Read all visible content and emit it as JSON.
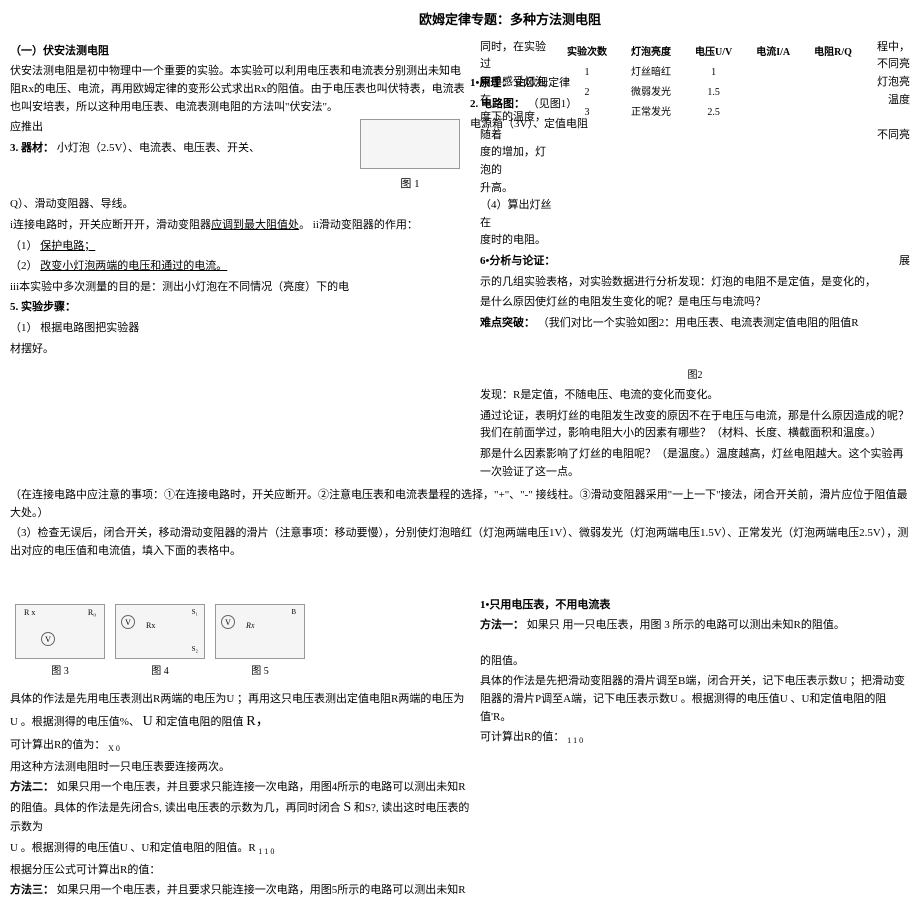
{
  "title": "欧姆定律专题：多种方法测电阻",
  "section1": {
    "header": "（一）伏安法测电阻",
    "intro": "伏安法测电阻是初中物理中一个重要的实验。本实验可以利用电压表和电流表分别测出未知电阻Rx的电压、电流，再用欧姆定律的变形公式求出Rx的阻值。由于电压表也叫伏特表，电流表也叫安培表，所以这种用电压表、电流表测电阻的方法叫\"伏安法\"。",
    "principle_label": "1•原理：",
    "principle_text": "由欧姆定律",
    "derive": "应推出",
    "circuit_label": "2. 电路图：",
    "circuit_text": "（见图1）",
    "equipment_label": "3. 器材：",
    "equipment_text": "小灯泡（2.5V）、电流表、电压表、开关、",
    "equipment_text2": "电源箱（3V）、定值电阻",
    "equipment_text3": "Q）、滑动变阻器、导线。",
    "fig1_label": "图 1",
    "note_i": "i连接电路时，开关应断开开，滑动变阻器",
    "note_i_underline": "应调到最大阻值处",
    "note_i_end": "。   ii滑动变阻器的作用：",
    "note1_label": "（1）",
    "note1": "保护电路；",
    "note2_label": "（2）",
    "note2": "改变小灯泡两端的电压和通过的电流。",
    "note_iii": "iii本实验中多次测量的目的是：测出小灯泡在不同情况（亮度）下的电",
    "step5_label": "5. 实验步骤：",
    "step5_1_label": "（1）",
    "step5_1": "根据电路图把实验器",
    "step5_1_end": "材摆好。",
    "warning": "（在连接电路中应注意的事项：①在连接电路时，开关应断开。②注意电压表和电流表量程的选择，\"+\"、\"-\" 接线柱。③滑动变阻器采用\"一上一下\"接法，闭合开关前，滑片应位于阻值最大处。）",
    "step3": "（3）检查无误后，闭合开关，移动滑动变阻器的滑片（注意事项：移动要慢），分别使灯泡暗红（灯泡两端电压1V）、微弱发光（灯泡两端电压1.5V）、正常发光（灯泡两端电压2.5V），测出对应的电压值和电流值，填入下面的表格中。"
  },
  "rightside": {
    "intro": "同时，在实验过",
    "intro2": "用手感受灯泡在",
    "intro3": "度下的温度，随着",
    "intro4": "度的增加，灯泡的",
    "intro5": "升高。",
    "end1": "程中，",
    "end2": "不同亮",
    "end3": "灯泡亮",
    "end4": "温度",
    "step4_label": "（4）算出灯丝在",
    "step4_text": "度时的电阻。",
    "end5": "不同亮",
    "section6_label": "6•分析与论证：",
    "section6_text": "展",
    "sec6_1": "示的几组实验表格，对实验数据进行分析发现：灯泡的电阻不是定值，是变化的，",
    "sec6_2": "是什么原因使灯丝的电阻发生变化的呢？是电压与电流吗？",
    "difficult_label": "难点突破：",
    "difficult_text": "（我们对比一个实验如图2：用电压表、电流表测定值电阻的阻值R",
    "fig2_label": "图2",
    "discover": "发现：R是定值，不随电压、电流的变化而变化。",
    "conclusion": "通过论证，表明灯丝的电阻发生改变的原因不在于电压与电流，那是什么原因造成的呢？我们在前面学过，影响电阻大小的因素有哪些？（材料、长度、横截面积和温度。）",
    "conclusion2": "那是什么因素影响了灯丝的电阻呢？（是温度。）温度越高，灯丝电阻越大。这个实验再一次验证了这一点。"
  },
  "table": {
    "headers": [
      "实验次数",
      "灯泡亮度",
      "电压U/V",
      "电流I/A",
      "电阻R/Q"
    ],
    "rows": [
      [
        "1",
        "灯丝暗红",
        "1",
        "",
        ""
      ],
      [
        "2",
        "微弱发光",
        "1.5",
        "",
        ""
      ],
      [
        "3",
        "正常发光",
        "2.5",
        "",
        ""
      ]
    ]
  },
  "section_bottom": {
    "method_header": "1•只用电压表，不用电流表",
    "method1_label": "方法一：",
    "method1_text": "如果只 用一只电压表，用图 3 所示的电路可以测出未知R的阻值。",
    "method1_detail": "具体的作法是先用电压表测出R两端的电压为U  ；再用这只电压表测出定值电阻R两端的电压为",
    "method1_calc1": "U 。根据测得的电压值%、",
    "method1_u": "U",
    "method1_calc1b": "和定值电阻的阻值",
    "method1_r": "R，",
    "method1_calc2": "可计算出R的值为：",
    "method1_x0": "X   0",
    "method1_note": "用这种方法测电阻时一只电压表要连接两次。",
    "method2_label": "方法二：",
    "method2_text": "如果只用一个电压表，并且要求只能连接一次电路，用图4所示的电路可以测出未知R的阻值。具体的作法是先闭合S, 读出电压表的示数为几，再同时闭合",
    "method2_s": "S",
    "method2_text2": "和S?, 读出这时电压表的示数为",
    "method2_calc": "U 。根据测得的电压值U 、U和定值电阻的阻值。R",
    "method2_calc2": "根据分压公式可计算出R的值：",
    "method2_sub": "1 1   0",
    "method3_label": "方法三：",
    "method3_text": "如果只用一个电压表，并且要求只能连接一次电路，用图5所示的电路可以测出未知R",
    "fig3": "图 3",
    "fig4": "图 4",
    "fig5": "图 5",
    "r_label": "R x",
    "r0_label": "R₀",
    "rx_label": "Rx",
    "right_text1": "的阻值。",
    "right_text2": "具体的作法是先把滑动变阻器的滑片调至B端，闭合开关，记下电压表示数U  ；把滑动变阻器的滑片P调至A端，记下电压表示数U 。根据测得的电压值U 、U和定值电阻的阻值'R。",
    "right_text3": "可计算出R的值：",
    "right_sub": "1 1   0"
  }
}
